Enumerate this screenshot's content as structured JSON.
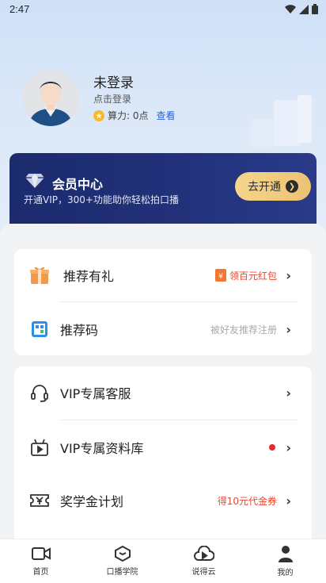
{
  "status_bar": {
    "time": "2:47"
  },
  "profile": {
    "username": "未登录",
    "login_hint": "点击登录",
    "points_text": "算力: 0点",
    "view_link": "查看"
  },
  "vip": {
    "title": "会员中心",
    "description": "开通VIP，300+功能助你轻松拍口播",
    "button_label": "去开通"
  },
  "group1": [
    {
      "label": "推荐有礼",
      "right_text": "领百元红包",
      "right_color": "#e8462f",
      "icon": "gift-icon"
    },
    {
      "label": "推荐码",
      "right_text": "被好友推荐注册",
      "right_color": "#aaaaaa",
      "icon": "qr-code-icon"
    }
  ],
  "group2": [
    {
      "label": "VIP专属客服",
      "right_text": "",
      "icon": "headset-icon"
    },
    {
      "label": "VIP专属资料库",
      "right_text": "",
      "has_dot": true,
      "dot_color": "#e8262f",
      "icon": "video-library-icon"
    },
    {
      "label": "奖学金计划",
      "right_text": "得10元代金券",
      "right_color": "#e8462f",
      "icon": "yuan-ticket-icon"
    }
  ],
  "tabs": [
    {
      "label": "首页",
      "icon": "video-camera-icon"
    },
    {
      "label": "口播学院",
      "icon": "graduation-cap-icon"
    },
    {
      "label": "说得云",
      "icon": "cloud-play-icon"
    },
    {
      "label": "我的",
      "icon": "person-icon"
    }
  ]
}
